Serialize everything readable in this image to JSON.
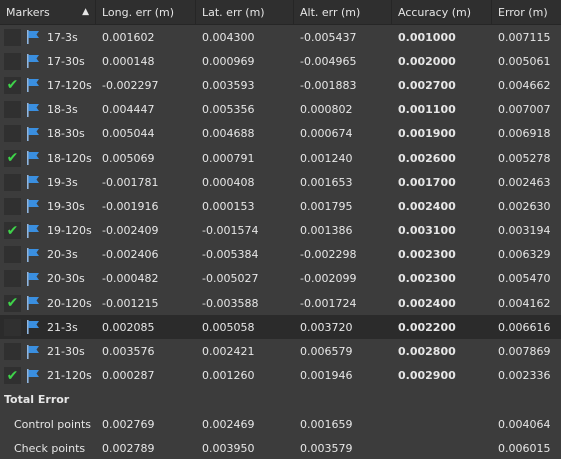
{
  "header": {
    "markers": "Markers",
    "long_err": "Long. err (m)",
    "lat_err": "Lat. err (m)",
    "alt_err": "Alt. err (m)",
    "accuracy": "Accuracy (m)",
    "error": "Error (m)"
  },
  "rows": [
    {
      "checked": false,
      "label": "17-3s",
      "long": "0.001602",
      "lat": "0.004300",
      "alt": "-0.005437",
      "acc": "0.001000",
      "err": "0.007115"
    },
    {
      "checked": false,
      "label": "17-30s",
      "long": "0.000148",
      "lat": "0.000969",
      "alt": "-0.004965",
      "acc": "0.002000",
      "err": "0.005061"
    },
    {
      "checked": true,
      "label": "17-120s",
      "long": "-0.002297",
      "lat": "0.003593",
      "alt": "-0.001883",
      "acc": "0.002700",
      "err": "0.004662"
    },
    {
      "checked": false,
      "label": "18-3s",
      "long": "0.004447",
      "lat": "0.005356",
      "alt": "0.000802",
      "acc": "0.001100",
      "err": "0.007007"
    },
    {
      "checked": false,
      "label": "18-30s",
      "long": "0.005044",
      "lat": "0.004688",
      "alt": "0.000674",
      "acc": "0.001900",
      "err": "0.006918"
    },
    {
      "checked": true,
      "label": "18-120s",
      "long": "0.005069",
      "lat": "0.000791",
      "alt": "0.001240",
      "acc": "0.002600",
      "err": "0.005278"
    },
    {
      "checked": false,
      "label": "19-3s",
      "long": "-0.001781",
      "lat": "0.000408",
      "alt": "0.001653",
      "acc": "0.001700",
      "err": "0.002463"
    },
    {
      "checked": false,
      "label": "19-30s",
      "long": "-0.001916",
      "lat": "0.000153",
      "alt": "0.001795",
      "acc": "0.002400",
      "err": "0.002630"
    },
    {
      "checked": true,
      "label": "19-120s",
      "long": "-0.002409",
      "lat": "-0.001574",
      "alt": "0.001386",
      "acc": "0.003100",
      "err": "0.003194"
    },
    {
      "checked": false,
      "label": "20-3s",
      "long": "-0.002406",
      "lat": "-0.005384",
      "alt": "-0.002298",
      "acc": "0.002300",
      "err": "0.006329"
    },
    {
      "checked": false,
      "label": "20-30s",
      "long": "-0.000482",
      "lat": "-0.005027",
      "alt": "-0.002099",
      "acc": "0.002300",
      "err": "0.005470"
    },
    {
      "checked": true,
      "label": "20-120s",
      "long": "-0.001215",
      "lat": "-0.003588",
      "alt": "-0.001724",
      "acc": "0.002400",
      "err": "0.004162"
    },
    {
      "checked": false,
      "label": "21-3s",
      "long": "0.002085",
      "lat": "0.005058",
      "alt": "0.003720",
      "acc": "0.002200",
      "err": "0.006616",
      "selected": true
    },
    {
      "checked": false,
      "label": "21-30s",
      "long": "0.003576",
      "lat": "0.002421",
      "alt": "0.006579",
      "acc": "0.002800",
      "err": "0.007869"
    },
    {
      "checked": true,
      "label": "21-120s",
      "long": "0.000287",
      "lat": "0.001260",
      "alt": "0.001946",
      "acc": "0.002900",
      "err": "0.002336"
    }
  ],
  "total": {
    "title": "Total Error",
    "control": {
      "label": "Control points",
      "long": "0.002769",
      "lat": "0.002469",
      "alt": "0.001659",
      "err": "0.004064"
    },
    "check": {
      "label": "Check points",
      "long": "0.002789",
      "lat": "0.003950",
      "alt": "0.003579",
      "err": "0.006015"
    }
  },
  "icons": {
    "flag": "flag-icon",
    "check": "checkmark-icon",
    "sort": "sort-ascending-icon"
  },
  "colors": {
    "flag": "#3a8fe0",
    "check": "#3fd34a",
    "bg": "#3c3c3c",
    "header_bg": "#2f2f2f"
  }
}
